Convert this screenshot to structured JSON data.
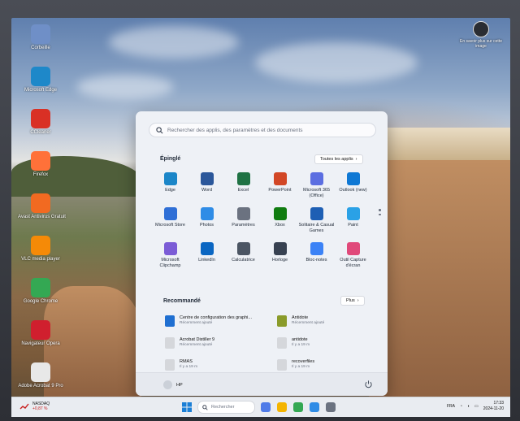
{
  "desktop": {
    "icons": [
      {
        "label": "Corbeille",
        "icon": "recycle-bin-icon",
        "color": "#6f8fc7"
      },
      {
        "label": "Microsoft Edge",
        "icon": "edge-icon",
        "color": "#1e88c9"
      },
      {
        "label": "CCleaner",
        "icon": "ccleaner-icon",
        "color": "#d93025"
      },
      {
        "label": "Firefox",
        "icon": "firefox-icon",
        "color": "#ff7139"
      },
      {
        "label": "Avast Antivirus Gratuit",
        "icon": "avast-icon",
        "color": "#f26a21"
      },
      {
        "label": "VLC media player",
        "icon": "vlc-icon",
        "color": "#f58a07"
      },
      {
        "label": "Google Chrome",
        "icon": "chrome-icon",
        "color": "#34a853"
      },
      {
        "label": "Navigateur Opera",
        "icon": "opera-icon",
        "color": "#d01f2e"
      },
      {
        "label": "Adobe Acrobat 9 Pro",
        "icon": "acrobat-icon",
        "color": "#e8e8e8"
      }
    ],
    "right_icon": {
      "label": "En savoir plus sur cette image",
      "icon": "camera-icon"
    }
  },
  "start_menu": {
    "search_placeholder": "Rechercher des applis, des paramètres et des documents",
    "pinned_title": "Épinglé",
    "all_apps_label": "Toutes les applis",
    "pinned_apps": [
      {
        "label": "Edge",
        "icon": "edge-icon",
        "color": "#1b86c8"
      },
      {
        "label": "Word",
        "icon": "word-icon",
        "color": "#2b579a"
      },
      {
        "label": "Excel",
        "icon": "excel-icon",
        "color": "#1f7244"
      },
      {
        "label": "PowerPoint",
        "icon": "powerpoint-icon",
        "color": "#d24726"
      },
      {
        "label": "Microsoft 365 (Office)",
        "icon": "office-icon",
        "color": "#5b6ee1"
      },
      {
        "label": "Outlook (new)",
        "icon": "outlook-icon",
        "color": "#0f78d4"
      },
      {
        "label": "Microsoft Store",
        "icon": "store-icon",
        "color": "#2f6fd6"
      },
      {
        "label": "Photos",
        "icon": "photos-icon",
        "color": "#2f8ce6"
      },
      {
        "label": "Paramètres",
        "icon": "settings-icon",
        "color": "#6b7280"
      },
      {
        "label": "Xbox",
        "icon": "xbox-icon",
        "color": "#107c10"
      },
      {
        "label": "Solitaire & Casual Games",
        "icon": "solitaire-icon",
        "color": "#1e5fb4"
      },
      {
        "label": "Paint",
        "icon": "paint-icon",
        "color": "#2aa1e6"
      },
      {
        "label": "Microsoft Clipchamp",
        "icon": "clipchamp-icon",
        "color": "#7b5cd6"
      },
      {
        "label": "LinkedIn",
        "icon": "linkedin-icon",
        "color": "#0a66c2"
      },
      {
        "label": "Calculatrice",
        "icon": "calculator-icon",
        "color": "#4b5563"
      },
      {
        "label": "Horloge",
        "icon": "clock-icon",
        "color": "#374151"
      },
      {
        "label": "Bloc-notes",
        "icon": "notepad-icon",
        "color": "#3b82f6"
      },
      {
        "label": "Outil Capture d'écran",
        "icon": "snipping-tool-icon",
        "color": "#e0497a"
      }
    ],
    "recommended_title": "Recommandé",
    "more_label": "Plus",
    "recommended": [
      {
        "title": "Centre de configuration des graphi...",
        "subtitle": "Récemment ajouté",
        "icon": "graphics-center-icon",
        "color": "#1f6fd1"
      },
      {
        "title": "Antidote",
        "subtitle": "Récemment ajouté",
        "icon": "antidote-icon",
        "color": "#8a9b2a"
      },
      {
        "title": "Acrobat Distiller 9",
        "subtitle": "Récemment ajouté",
        "icon": "acrobat-distiller-icon",
        "color": "#d5d7db"
      },
      {
        "title": "antidote",
        "subtitle": "Il y a 19 m",
        "icon": "file-icon",
        "color": "#d5d7db"
      },
      {
        "title": "RMAS",
        "subtitle": "Il y a 19 m",
        "icon": "file-icon",
        "color": "#d5d7db"
      },
      {
        "title": "recoverfiles",
        "subtitle": "Il y a 19 m",
        "icon": "file-icon",
        "color": "#d5d7db"
      }
    ],
    "user_name": "HP"
  },
  "taskbar": {
    "stock_name": "NASDAQ",
    "stock_change": "+0,87 %",
    "search_placeholder": "Rechercher",
    "apps": [
      {
        "icon": "copilot-icon",
        "color": "#4f7be8"
      },
      {
        "icon": "file-explorer-icon",
        "color": "#f4b400"
      },
      {
        "icon": "chrome-icon",
        "color": "#34a853"
      },
      {
        "icon": "photos-icon",
        "color": "#2f8ce6"
      },
      {
        "icon": "settings-icon",
        "color": "#6b7280"
      }
    ],
    "language": "FRA",
    "time": "17:33",
    "date": "2024-11-20"
  }
}
